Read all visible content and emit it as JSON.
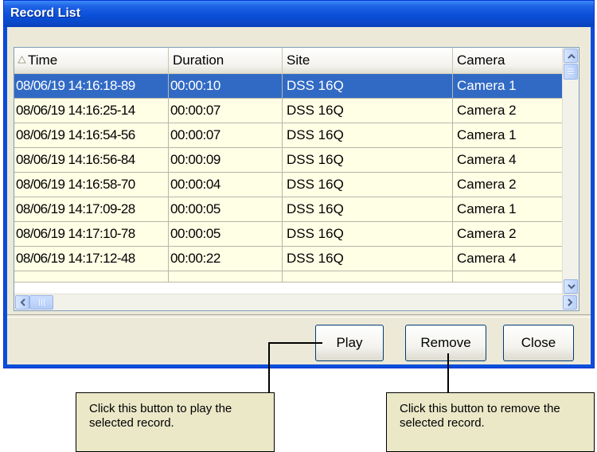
{
  "window": {
    "title": "Record List"
  },
  "columns": [
    "Time",
    "Duration",
    "Site",
    "Camera"
  ],
  "rows": [
    {
      "time": "08/06/19 14:16:18-89",
      "duration": "00:00:10",
      "site": "DSS 16Q",
      "camera": "Camera 1",
      "selected": true
    },
    {
      "time": "08/06/19 14:16:25-14",
      "duration": "00:00:07",
      "site": "DSS 16Q",
      "camera": "Camera 2"
    },
    {
      "time": "08/06/19 14:16:54-56",
      "duration": "00:00:07",
      "site": "DSS 16Q",
      "camera": "Camera 1"
    },
    {
      "time": "08/06/19 14:16:56-84",
      "duration": "00:00:09",
      "site": "DSS 16Q",
      "camera": "Camera 4"
    },
    {
      "time": "08/06/19 14:16:58-70",
      "duration": "00:00:04",
      "site": "DSS 16Q",
      "camera": "Camera 2"
    },
    {
      "time": "08/06/19 14:17:09-28",
      "duration": "00:00:05",
      "site": "DSS 16Q",
      "camera": "Camera 1"
    },
    {
      "time": "08/06/19 14:17:10-78",
      "duration": "00:00:05",
      "site": "DSS 16Q",
      "camera": "Camera 2"
    },
    {
      "time": "08/06/19 14:17:12-48",
      "duration": "00:00:22",
      "site": "DSS 16Q",
      "camera": "Camera 4"
    }
  ],
  "buttons": {
    "play": "Play",
    "remove": "Remove",
    "close": "Close"
  },
  "callouts": {
    "play": "Click this button to play the selected record.",
    "remove": "Click this button to remove the selected record."
  },
  "colors": {
    "title_bar": "#0a4fd8",
    "selection": "#316ac5",
    "row_background": "#ffffe6",
    "callout_background": "#ebe8c8"
  },
  "icons": [
    "sort-ascending-icon",
    "scroll-up-arrow-icon",
    "scroll-down-arrow-icon",
    "scroll-left-arrow-icon",
    "scroll-right-arrow-icon"
  ]
}
